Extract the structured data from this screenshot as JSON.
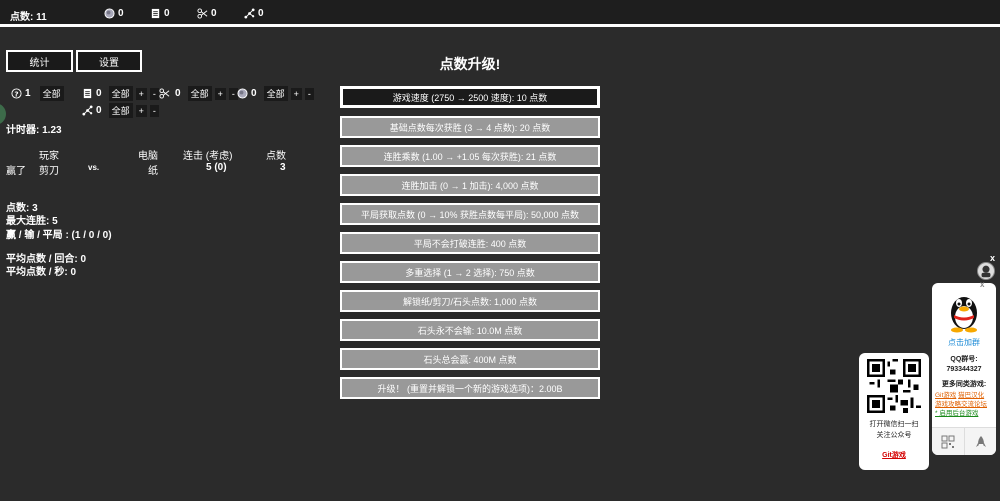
{
  "topbar": {
    "points": "点数: 11",
    "rock_count": "0",
    "paper_count": "0",
    "scissors_count": "0",
    "other_count": "0"
  },
  "buttons": {
    "stats": "统计",
    "settings": "设置"
  },
  "inventory": {
    "unknown_count": "1",
    "paper_count": "0",
    "scissors_count": "0",
    "rock_count": "0",
    "other_count": "0",
    "all_label": "全部",
    "plus": "+",
    "minus": "-"
  },
  "timer": "计时器: 1.23",
  "table": {
    "headers": {
      "player": "玩家",
      "computer": "电脑",
      "combo": "连击 (考虑)",
      "points": "点数"
    },
    "row": {
      "result": "赢了",
      "player": "剪刀",
      "vs": "vs.",
      "computer": "纸",
      "combo": "5 (0)",
      "points": "3"
    }
  },
  "stats": {
    "points": "点数: 3",
    "max_streak": "最大连胜:   5",
    "wlt": "赢 / 输 / 平局 : (1 / 0 / 0)",
    "avg_round": "平均点数 / 回合: 0",
    "avg_sec": "平均点数 / 秒: 0"
  },
  "upgrades": {
    "title": "点数升级!",
    "items": [
      "游戏速度 (2750 → 2500 速度): 10 点数",
      "基础点数每次获胜 (3 → 4 点数): 20 点数",
      "连胜乘数 (1.00 → +1.05 每次获胜): 21 点数",
      "连胜加击 (0 → 1 加击): 4,000 点数",
      "平局获取点数 (0 → 10% 获胜点数每平局): 50,000 点数",
      "平局不会打破连胜: 400 点数",
      "多重选择 (1 → 2 选择): 750 点数",
      "解锁纸/剪刀/石头点数: 1,000 点数",
      "石头永不会输: 10.0M 点数",
      "石头总会赢: 400M 点数",
      "升级！ (重置并解锁一个新的游戏选项)：2.00B"
    ]
  },
  "widget": {
    "close": "x",
    "qq_join": "点击加群",
    "qq_group_label": "QQ群号:",
    "qq_group_number": "793344327",
    "more_games": "更多同类游戏:",
    "link1": "Git游戏",
    "link2": "猫巴汉化",
    "link3": "游戏攻略交流论坛",
    "link4": "* 启用后台游戏",
    "wx_text1": "打开微信扫一扫",
    "wx_text2": "关注公众号",
    "wx_link": "Git游戏"
  },
  "colors": {
    "bg": "#2b2b2b",
    "topbar": "#1e1e1e",
    "upgrade_bg": "#999999",
    "link_orange": "#e06000",
    "link_green": "#1a8a1a",
    "qq_blue": "#1b8ad6"
  }
}
